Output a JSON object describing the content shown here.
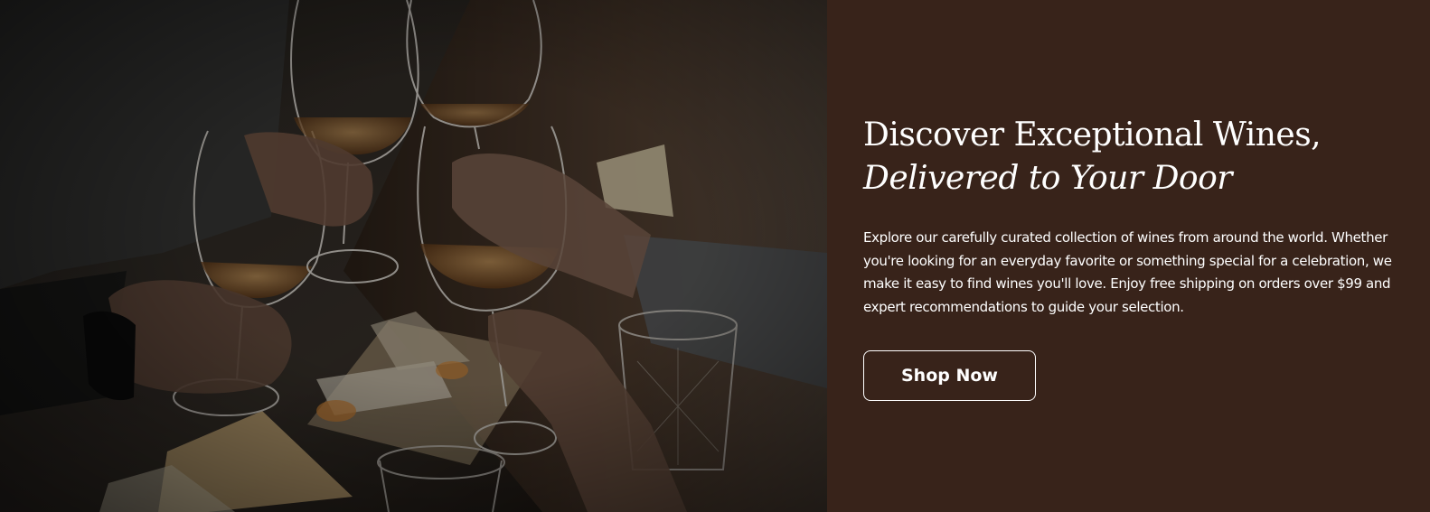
{
  "hero": {
    "image": {
      "subject": "friends-toasting-wine-glasses-over-cheese-board"
    },
    "headline_line_1": "Discover Exceptional Wines,",
    "headline_line_2": "Delivered to Your Door",
    "description": "Explore our carefully curated collection of wines from around the world. Whether you're looking for an everyday favorite or something special for a celebration, we make it easy to find wines you'll love. Enjoy free shipping on orders over $99 and expert recommendations to guide your selection.",
    "cta_label": "Shop Now"
  },
  "colors": {
    "panel_background": "#38231a",
    "text": "#ffffff",
    "button_border": "#ffffff"
  }
}
